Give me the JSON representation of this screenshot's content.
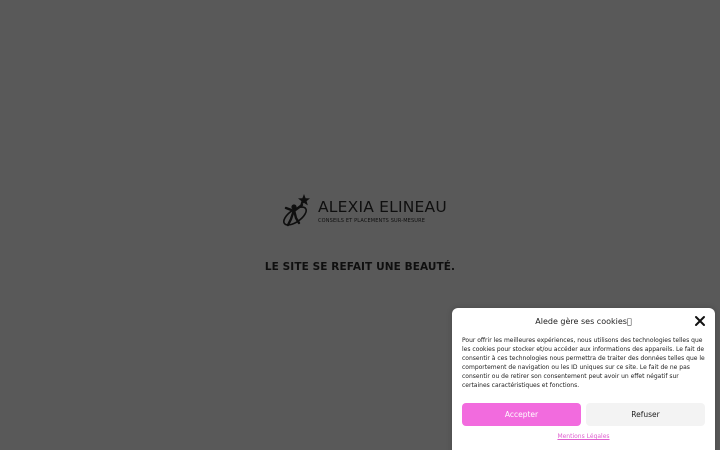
{
  "brand": {
    "name": "ALEXIA ELINEAU",
    "tagline": "CONSEILS ET PLACEMENTS SUR-MESURE",
    "logo_icon": "star-person-orbit-icon"
  },
  "headline": "LE SITE SE REFAIT UNE BEAUTÉ.",
  "cookie_banner": {
    "title": "Alede gère ses cookies",
    "close_icon": "close-icon",
    "body": "Pour offrir les meilleures expériences, nous utilisons des technologies telles que les cookies pour stocker et/ou accéder aux informations des appareils. Le fait de consentir à ces technologies nous permettra de traiter des données telles que le comportement de navigation ou les ID uniques sur ce site. Le fait de ne pas consentir ou de retirer son consentement peut avoir un effet négatif sur certaines caractéristiques et fonctions.",
    "accept_label": "Accepter",
    "refuse_label": "Refuser",
    "legal_link": "Mentions Légales"
  },
  "colors": {
    "background": "#595959",
    "accent": "#f26bde",
    "link": "#e05fd0"
  }
}
